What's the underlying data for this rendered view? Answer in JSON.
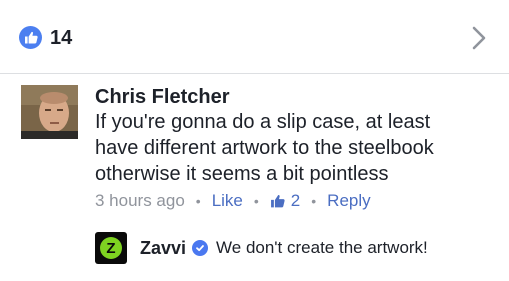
{
  "reactions": {
    "count": "14",
    "icon": "like-icon",
    "color": "#4c7ff0"
  },
  "header": {
    "chevron_icon": "chevron-right-icon"
  },
  "comment": {
    "author": "Chris Fletcher",
    "text": "If you're gonna do a slip case, at least have different artwork to the steelbook otherwise it seems a bit pointless",
    "timestamp": "3 hours ago",
    "like_label": "Like",
    "like_count": "2",
    "reply_label": "Reply",
    "separator": "•"
  },
  "reply": {
    "author": "Zavvi",
    "logo_letter": "Z",
    "logo_color": "#7ed321",
    "verified_icon": "verified-badge-icon",
    "text": "We don't create the artwork!"
  }
}
